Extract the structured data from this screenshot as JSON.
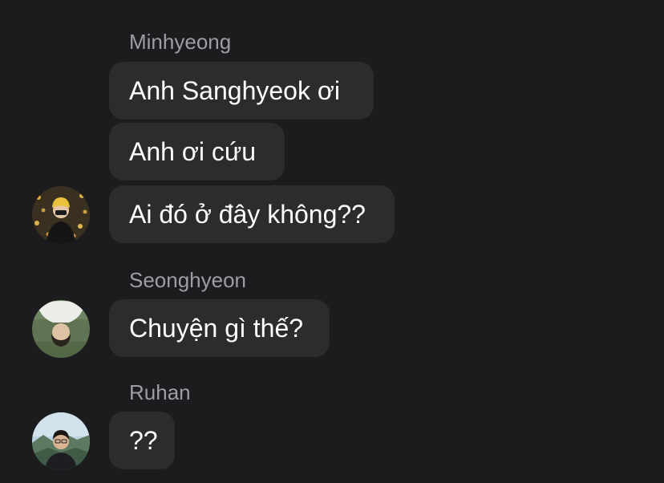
{
  "thread": [
    {
      "sender": "Minhyeong",
      "avatar_icon": "person-photo-avatar",
      "messages": [
        "Anh Sanghyeok ơi",
        "Anh ơi cứu",
        "Ai đó ở đây không??"
      ]
    },
    {
      "sender": "Seonghyeon",
      "avatar_icon": "person-photo-avatar",
      "messages": [
        "Chuyện gì thế?"
      ]
    },
    {
      "sender": "Ruhan",
      "avatar_icon": "person-photo-avatar",
      "messages": [
        "??"
      ]
    }
  ],
  "colors": {
    "background": "#1c1c1e",
    "bubble": "#2c2c2e",
    "sender_name": "#9d9da3",
    "text": "#ffffff"
  }
}
